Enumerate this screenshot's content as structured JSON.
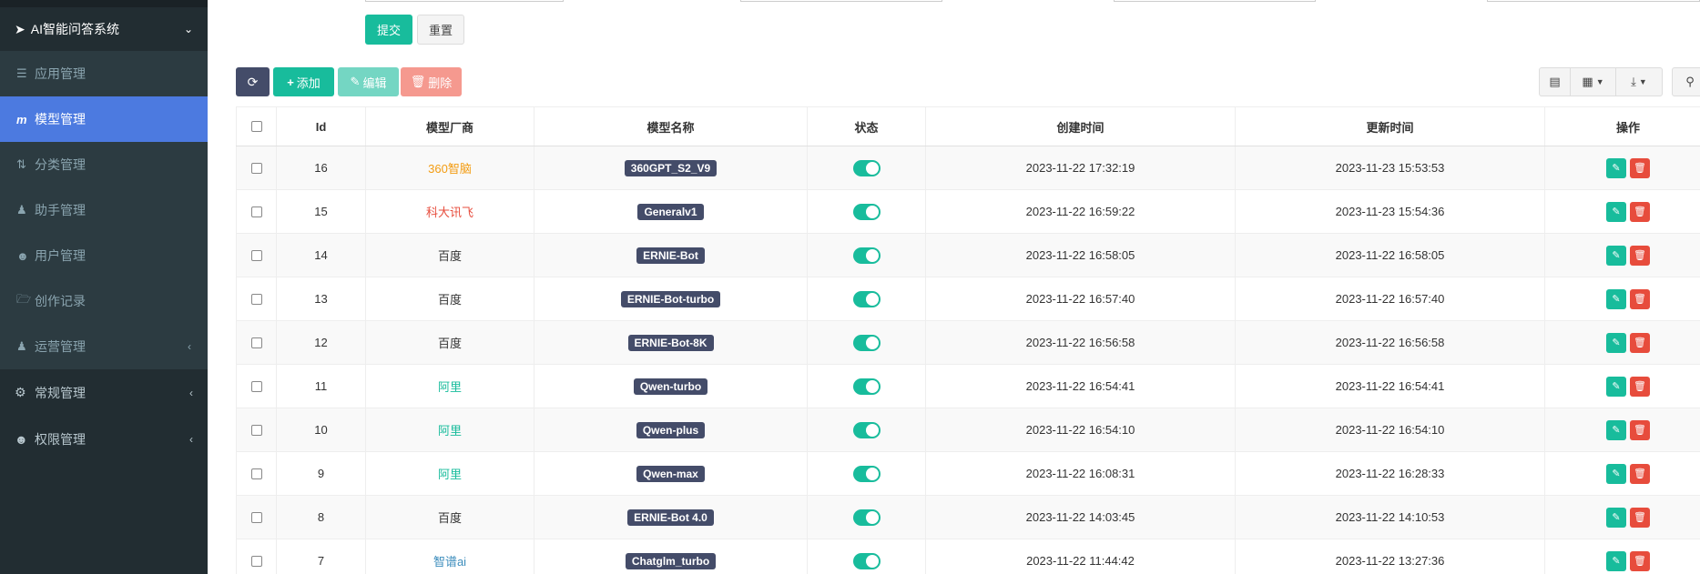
{
  "sidebar": {
    "app_title": "AI智能问答系统",
    "items": [
      {
        "label": "应用管理",
        "icon": "list-icon"
      },
      {
        "label": "模型管理",
        "icon": "m-icon",
        "active": true
      },
      {
        "label": "分类管理",
        "icon": "sort-icon"
      },
      {
        "label": "助手管理",
        "icon": "person-icon"
      },
      {
        "label": "用户管理",
        "icon": "user-icon"
      },
      {
        "label": "创作记录",
        "icon": "folder-open-icon"
      },
      {
        "label": "运营管理",
        "icon": "person-icon"
      }
    ],
    "roots": [
      {
        "label": "常规管理",
        "icon": "cogs-icon"
      },
      {
        "label": "权限管理",
        "icon": "group-icon"
      }
    ]
  },
  "form": {
    "submit_label": "提交",
    "reset_label": "重置"
  },
  "toolbar": {
    "add_label": "添加",
    "edit_label": "编辑",
    "delete_label": "删除"
  },
  "table": {
    "headers": [
      "Id",
      "模型厂商",
      "模型名称",
      "状态",
      "创建时间",
      "更新时间",
      "操作"
    ],
    "rows": [
      {
        "id": "16",
        "vendor": "360智脑",
        "vendor_color": "#f39c12",
        "name": "360GPT_S2_V9",
        "created": "2023-11-22 17:32:19",
        "updated": "2023-11-23 15:53:53"
      },
      {
        "id": "15",
        "vendor": "科大讯飞",
        "vendor_color": "#e74c3c",
        "name": "Generalv1",
        "created": "2023-11-22 16:59:22",
        "updated": "2023-11-23 15:54:36"
      },
      {
        "id": "14",
        "vendor": "百度",
        "vendor_color": "#333333",
        "name": "ERNIE-Bot",
        "created": "2023-11-22 16:58:05",
        "updated": "2023-11-22 16:58:05"
      },
      {
        "id": "13",
        "vendor": "百度",
        "vendor_color": "#333333",
        "name": "ERNIE-Bot-turbo",
        "created": "2023-11-22 16:57:40",
        "updated": "2023-11-22 16:57:40"
      },
      {
        "id": "12",
        "vendor": "百度",
        "vendor_color": "#333333",
        "name": "ERNIE-Bot-8K",
        "created": "2023-11-22 16:56:58",
        "updated": "2023-11-22 16:56:58"
      },
      {
        "id": "11",
        "vendor": "阿里",
        "vendor_color": "#18bc9c",
        "name": "Qwen-turbo",
        "created": "2023-11-22 16:54:41",
        "updated": "2023-11-22 16:54:41"
      },
      {
        "id": "10",
        "vendor": "阿里",
        "vendor_color": "#18bc9c",
        "name": "Qwen-plus",
        "created": "2023-11-22 16:54:10",
        "updated": "2023-11-22 16:54:10"
      },
      {
        "id": "9",
        "vendor": "阿里",
        "vendor_color": "#18bc9c",
        "name": "Qwen-max",
        "created": "2023-11-22 16:08:31",
        "updated": "2023-11-22 16:28:33"
      },
      {
        "id": "8",
        "vendor": "百度",
        "vendor_color": "#333333",
        "name": "ERNIE-Bot 4.0",
        "created": "2023-11-22 14:03:45",
        "updated": "2023-11-22 14:10:53"
      },
      {
        "id": "7",
        "vendor": "智谱ai",
        "vendor_color": "#3c8dbc",
        "name": "Chatglm_turbo",
        "created": "2023-11-22 11:44:42",
        "updated": "2023-11-22 13:27:36"
      }
    ]
  },
  "colors": {
    "accent": "#18bc9c",
    "danger": "#e74c3c",
    "primary": "#4c7ae0",
    "dark": "#444c69",
    "sidebar": "#222d32"
  }
}
